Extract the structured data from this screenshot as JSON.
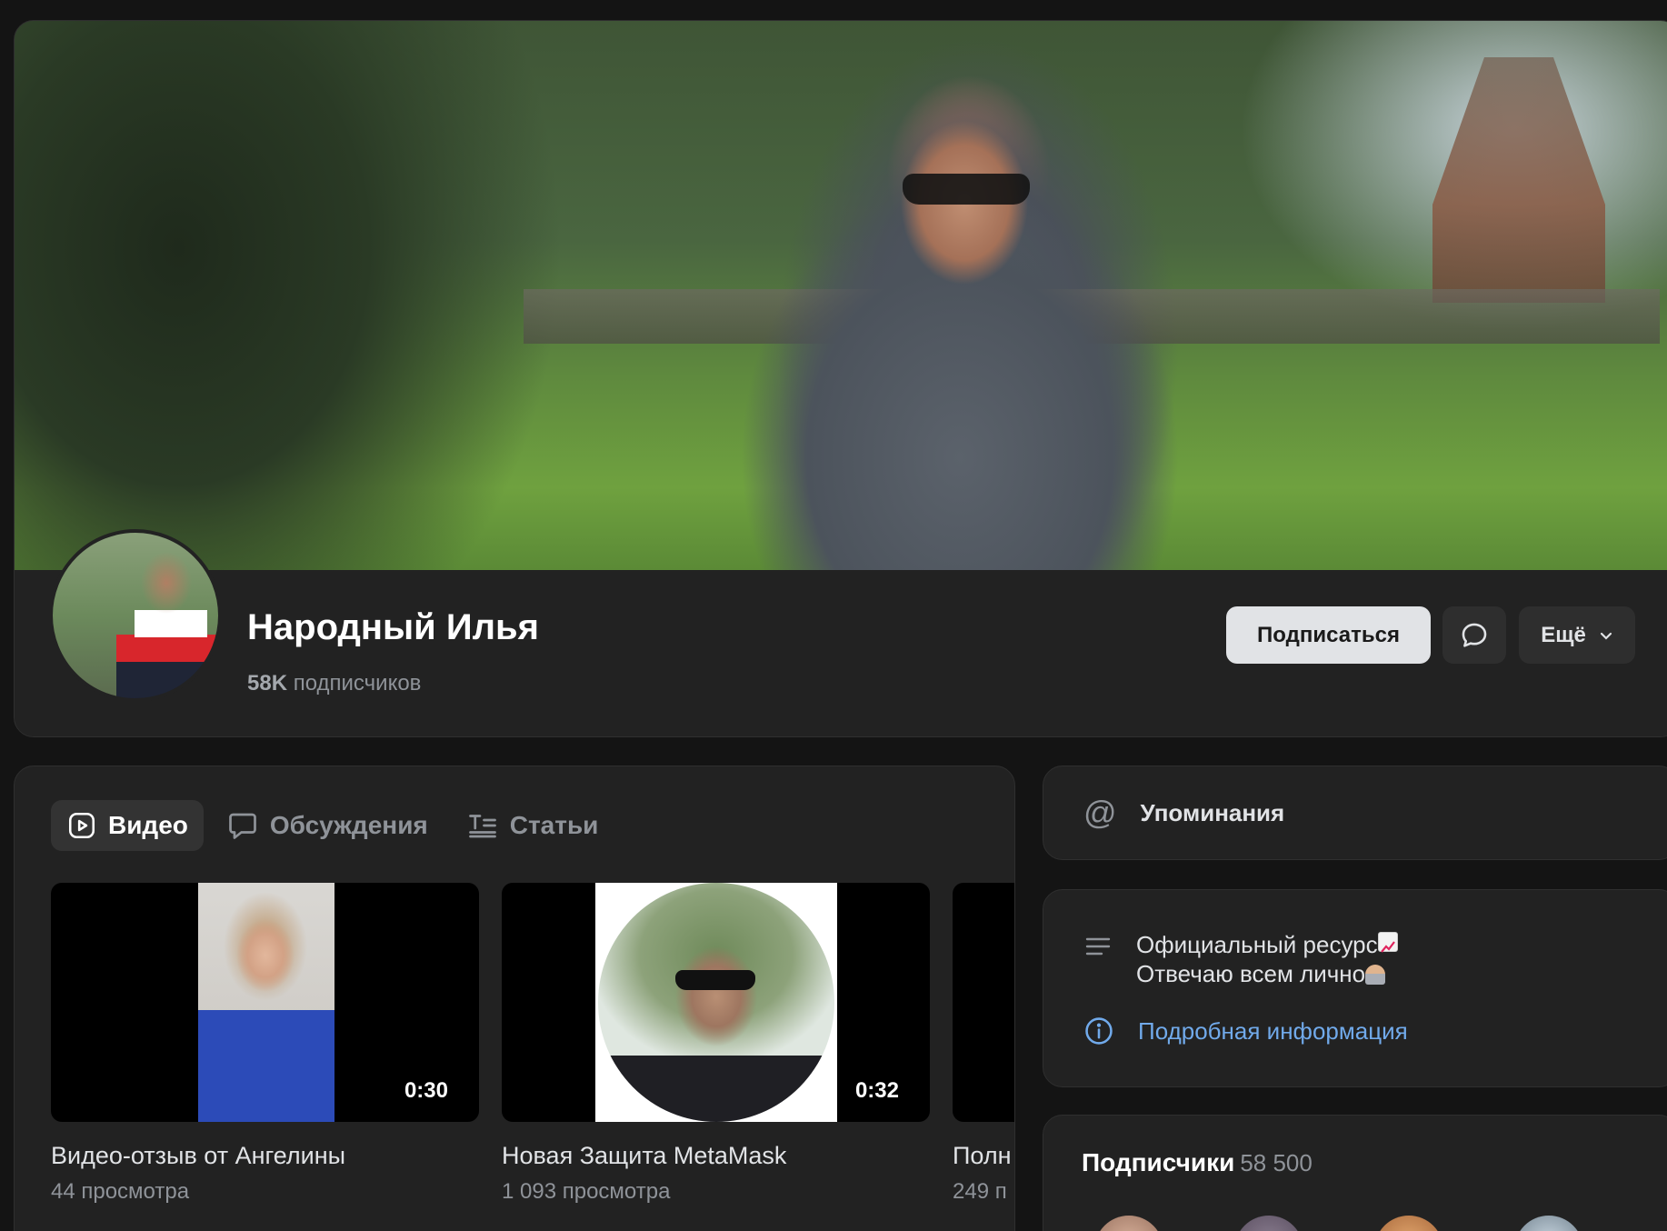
{
  "profile": {
    "name": "Народный Илья",
    "followers_count": "58K",
    "followers_label": "подписчиков",
    "subscribe_label": "Подписаться",
    "more_label": "Ещё"
  },
  "tabs": [
    {
      "label": "Видео",
      "active": true
    },
    {
      "label": "Обсуждения",
      "active": false
    },
    {
      "label": "Статьи",
      "active": false
    }
  ],
  "videos": [
    {
      "title": "Видео-отзыв от Ангелины",
      "views": "44 просмотра",
      "duration": "0:30"
    },
    {
      "title": "Новая Защита MetaMask",
      "views": "1 093 просмотра",
      "duration": "0:32"
    },
    {
      "title": "Полн",
      "views": "249 п",
      "duration": ""
    }
  ],
  "sidebar": {
    "mentions_label": "Упоминания",
    "about_line1": "Официальный ресурс",
    "about_line2": "Отвечаю всем лично",
    "more_info_label": "Подробная информация",
    "subscribers_title": "Подписчики",
    "subscribers_count": "58 500"
  },
  "colors": {
    "background": "#141414",
    "card": "#222222",
    "link": "#71aaeb",
    "primary_button": "#e1e3e6"
  },
  "icons": {
    "message": "chat-bubble-icon",
    "more": "chevron-down-icon",
    "video_tab": "play-square-icon",
    "discussions_tab": "chat-bubble-icon",
    "articles_tab": "text-list-icon",
    "mentions": "at-sign-icon",
    "about": "lines-icon",
    "info": "info-circle-icon"
  }
}
